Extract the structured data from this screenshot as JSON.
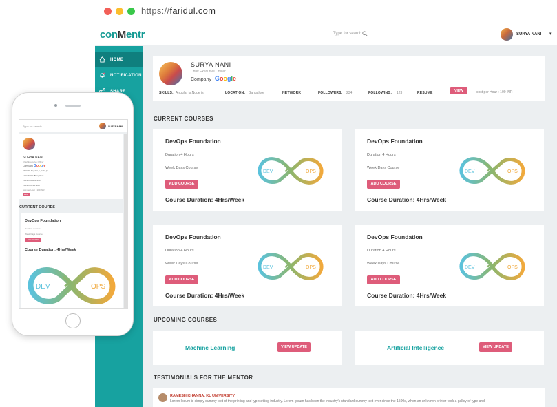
{
  "browser": {
    "url_scheme": "https://",
    "url_host": "faridul.com",
    "dot_colors": [
      "#f25f58",
      "#fbbe2e",
      "#39c84a"
    ]
  },
  "app": {
    "logo_prefix": "con",
    "logo_mark": "M",
    "logo_suffix": "entr",
    "search_placeholder": "Type for search",
    "user_name": "SURYA NANI",
    "accent_color": "#17a2a0",
    "button_color": "#de5c7a"
  },
  "sidebar": {
    "items": [
      {
        "label": "HOME",
        "icon": "home-icon"
      },
      {
        "label": "NOTIFICATION",
        "icon": "bell-icon"
      },
      {
        "label": "SHARE",
        "icon": "share-icon"
      }
    ]
  },
  "profile": {
    "name": "SURYA NANI",
    "role": "Chief Executive Officer",
    "company_label": "Company",
    "company_name": "Google",
    "skills_label": "SKILLS:",
    "skills_value": "Angular js,Node js",
    "location_label": "LOCATION:",
    "location_value": "Bangalore",
    "network_label": "NETWORK",
    "followers_label": "FOLLOWERS:",
    "followers_value": "234",
    "following_label": "FOLLOWING:",
    "following_value": "123",
    "resume_label": "RESUME",
    "view_label": "VIEW",
    "cost": "cost per Hour : 100 INR"
  },
  "current_courses": {
    "title": "CURRENT COURSES",
    "items": [
      {
        "title": "DevOps Foundation",
        "duration": "Duration 4 Hours",
        "days": "Week Days Course",
        "add_label": "ADD COURSE",
        "total": "Course Duration: 4Hrs/Week",
        "dev": "DEV",
        "ops": "OPS"
      },
      {
        "title": "DevOps Foundation",
        "duration": "Duration 4 Hours",
        "days": "Week Days Course",
        "add_label": "ADD COURSE",
        "total": "Course Duration: 4Hrs/Week",
        "dev": "DEV",
        "ops": "OPS"
      },
      {
        "title": "DevOps Foundation",
        "duration": "Duration 4 Hours",
        "days": "Week Days Course",
        "add_label": "ADD COURSE",
        "total": "Course Duration: 4Hrs/Week",
        "dev": "DEV",
        "ops": "OPS"
      },
      {
        "title": "DevOps Foundation",
        "duration": "Duration 4 Hours",
        "days": "Week Days Course",
        "add_label": "ADD COURSE",
        "total": "Course Duration: 4Hrs/Week",
        "dev": "DEV",
        "ops": "OPS"
      }
    ]
  },
  "upcoming_courses": {
    "title": "UPCOMING COURSES",
    "items": [
      {
        "title": "Machine Learning",
        "button": "VIEW UPDATE"
      },
      {
        "title": "Artificial Intelligence",
        "button": "VIEW UPDATE"
      }
    ]
  },
  "testimonials": {
    "title": "TESTIMONIALS FOR THE MENTOR",
    "author": "RAMESH KHANNA, KL UNIVERSITY",
    "text": "Lorem Ipsum is simply dummy text of the printing and typesetting industry. Lorem Ipsum has been the industry's standard dummy text ever since the 1500s, when an unknown printer took a galley of type and"
  },
  "phone": {
    "search_placeholder": "Type for search",
    "user_name": "SURYA NANI",
    "name": "SURYA NANI",
    "role": "Chief Executive Officer",
    "company_label": "Company",
    "company_name": "Google",
    "skills": "SKILLS: Angular js,Node js",
    "location": "LOCATION: Bangalore",
    "followers": "FOLLOWERS: 234",
    "following": "FOLLOWING: 123",
    "cost": "cost per Hour : 100 INR",
    "view_label": "VIEW",
    "section_title": "CURRENT COURES",
    "course_title": "DevOps Foundation",
    "course_duration": "Duration 4 Hours",
    "course_days": "Week Days Course",
    "add_label": "ADD COURSE",
    "course_total": "Course Duration: 4Hrs/Week",
    "dev": "DEV",
    "ops": "OPS"
  }
}
